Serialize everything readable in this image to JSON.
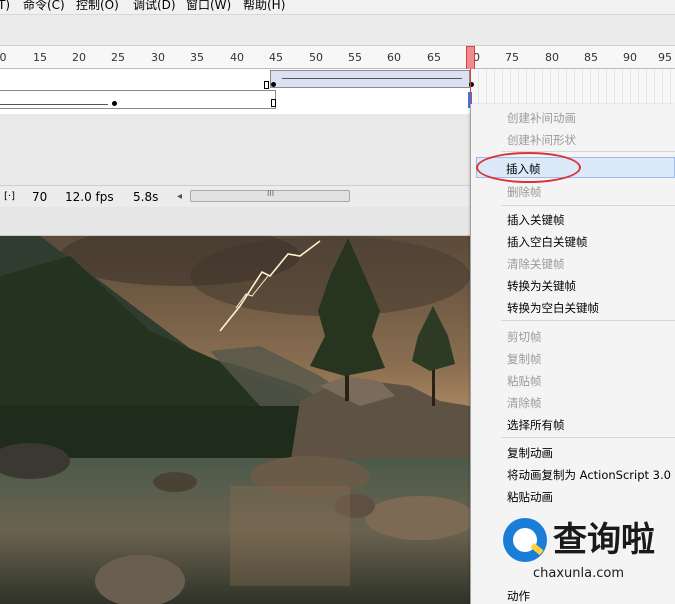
{
  "menubar": {
    "items": [
      "T)",
      "命令(C)",
      "控制(O)",
      "调试(D)",
      "窗口(W)",
      "帮助(H)"
    ]
  },
  "ruler": {
    "numbers": [
      "0",
      "15",
      "20",
      "25",
      "30",
      "35",
      "40",
      "45",
      "50",
      "55",
      "60",
      "65",
      "70",
      "75",
      "80",
      "85",
      "90",
      "95"
    ]
  },
  "status": {
    "frame": "70",
    "fps": "12.0 fps",
    "time": "5.8s",
    "icon_label": "[·]",
    "scroll_left": "◂",
    "scroll_grip": "III"
  },
  "context_menu": {
    "items": [
      {
        "label": "创建补间动画",
        "enabled": false
      },
      {
        "label": "创建补间形状",
        "enabled": false
      },
      {
        "label": "插入帧",
        "enabled": true,
        "highlighted": true
      },
      {
        "label": "删除帧",
        "enabled": false
      },
      {
        "label": "插入关键帧",
        "enabled": true
      },
      {
        "label": "插入空白关键帧",
        "enabled": true
      },
      {
        "label": "清除关键帧",
        "enabled": false
      },
      {
        "label": "转换为关键帧",
        "enabled": true
      },
      {
        "label": "转换为空白关键帧",
        "enabled": true
      },
      {
        "label": "剪切帧",
        "enabled": false
      },
      {
        "label": "复制帧",
        "enabled": false
      },
      {
        "label": "粘贴帧",
        "enabled": false
      },
      {
        "label": "清除帧",
        "enabled": false
      },
      {
        "label": "选择所有帧",
        "enabled": true
      },
      {
        "label": "复制动画",
        "enabled": true
      },
      {
        "label": "将动画复制为 ActionScript 3.0",
        "enabled": true
      },
      {
        "label": "粘贴动画",
        "enabled": true
      },
      {
        "label": "动作",
        "enabled": true
      }
    ]
  },
  "watermark": {
    "name": "查询啦",
    "domain": "chaxunla.com"
  },
  "colors": {
    "playhead": "#f28c8c",
    "highlight": "#dbe9f8",
    "callout_ring": "#d8343a",
    "watermark_blue": "#1a7ed8"
  }
}
